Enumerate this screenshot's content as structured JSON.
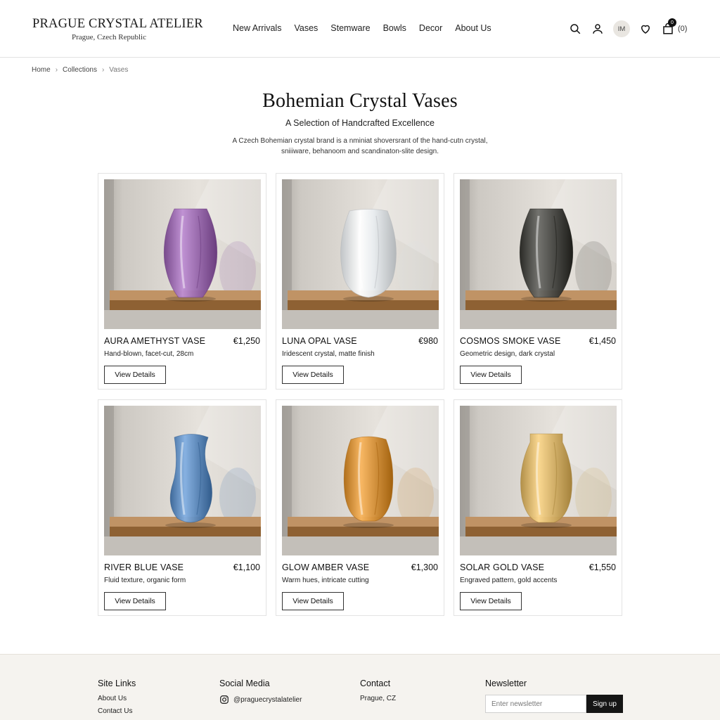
{
  "header": {
    "logo_title": "PRAGUE CRYSTAL ATELIER",
    "logo_subtitle": "Prague, Czech Republic",
    "nav": [
      "New Arrivals",
      "Vases",
      "Stemware",
      "Bowls",
      "Decor",
      "About Us"
    ],
    "avatar_initials": "IM",
    "cart_badge": "0",
    "cart_count": "(0)",
    "icons": [
      "search-icon",
      "user-icon",
      "heart-icon",
      "bag-icon"
    ]
  },
  "breadcrumb": {
    "items": [
      "Home",
      "Collections"
    ],
    "current": "Vases"
  },
  "hero": {
    "title": "Bohemian Crystal Vases",
    "subtitle": "A Selection of Handcrafted Excellence",
    "description": "A Czech Bohemian crystal brand is a nminiat shoversrant of the hand-cutn crystal, sniiiware, behanoom and scandinaton-slite design."
  },
  "products": [
    {
      "name": "AURA AMETHYST VASE",
      "price": "€1,250",
      "description": "Hand-blown, facet-cut, 28cm",
      "button": "View Details",
      "vase_color": "#9b6bb0",
      "vase_shape": "faceted"
    },
    {
      "name": "LUNA OPAL VASE",
      "price": "€980",
      "description": "Iridescent crystal, matte finish",
      "button": "View Details",
      "vase_color": "#e8ecef",
      "vase_shape": "ovoid"
    },
    {
      "name": "COSMOS SMOKE VASE",
      "price": "€1,450",
      "description": "Geometric design, dark crystal",
      "button": "View Details",
      "vase_color": "#4a4a46",
      "vase_shape": "faceted"
    },
    {
      "name": "RIVER BLUE VASE",
      "price": "€1,100",
      "description": "Fluid texture, organic form",
      "button": "View Details",
      "vase_color": "#5f8cbf",
      "vase_shape": "organic"
    },
    {
      "name": "GLOW AMBER VASE",
      "price": "€1,300",
      "description": "Warm hues, intricate cutting",
      "button": "View Details",
      "vase_color": "#d6923a",
      "vase_shape": "cut"
    },
    {
      "name": "SOLAR GOLD VASE",
      "price": "€1,550",
      "description": "Engraved pattern, gold accents",
      "button": "View Details",
      "vase_color": "#d8b46a",
      "vase_shape": "engraved"
    }
  ],
  "footer": {
    "site_links_title": "Site Links",
    "site_links": [
      "About Us",
      "Contact Us"
    ],
    "social_title": "Social Media",
    "instagram_handle": "@praguecrystalatelier",
    "contact_title": "Contact",
    "contact_location": "Prague, CZ",
    "newsletter_title": "Newsletter",
    "newsletter_placeholder": "Enter newsletter",
    "newsletter_button": "Sign up"
  },
  "colors": {
    "accent": "#151515",
    "footer_bg": "#f5f3ef",
    "shelf": "#a77a4c",
    "wall": "#dcd8d2"
  }
}
